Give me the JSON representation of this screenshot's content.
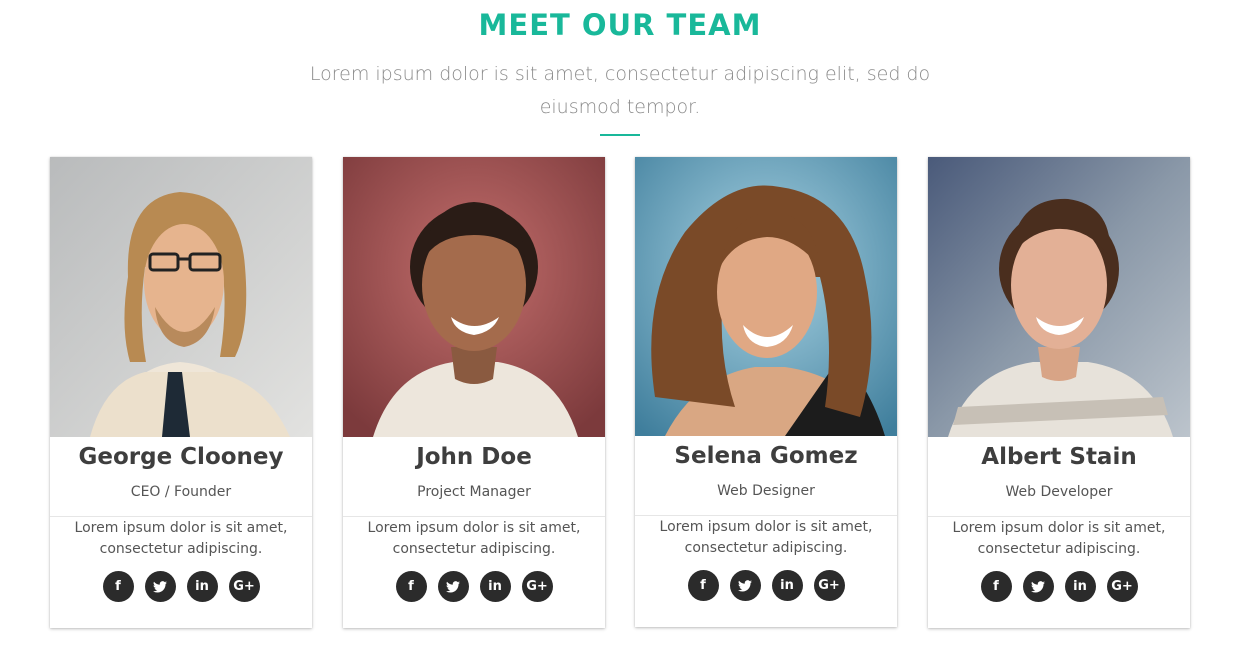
{
  "section": {
    "title": "MEET OUR TEAM",
    "subtitle": "Lorem ipsum dolor is sit amet, consectetur adipiscing elit, sed do eiusmod tempor."
  },
  "colors": {
    "accent": "#19b89a",
    "icon_bg": "#2b2b2b"
  },
  "social_icons": {
    "facebook": "f",
    "twitter": "🐦",
    "linkedin": "in",
    "google_plus": "G+"
  },
  "team": [
    {
      "name": "George Clooney",
      "role": "CEO / Founder",
      "bio": "Lorem ipsum dolor is sit amet, consectetur adipiscing."
    },
    {
      "name": "John Doe",
      "role": "Project Manager",
      "bio": "Lorem ipsum dolor is sit amet, consectetur adipiscing."
    },
    {
      "name": "Selena Gomez",
      "role": "Web Designer",
      "bio": "Lorem ipsum dolor is sit amet, consectetur adipiscing."
    },
    {
      "name": "Albert Stain",
      "role": "Web Developer",
      "bio": "Lorem ipsum dolor is sit amet, consectetur adipiscing."
    }
  ]
}
